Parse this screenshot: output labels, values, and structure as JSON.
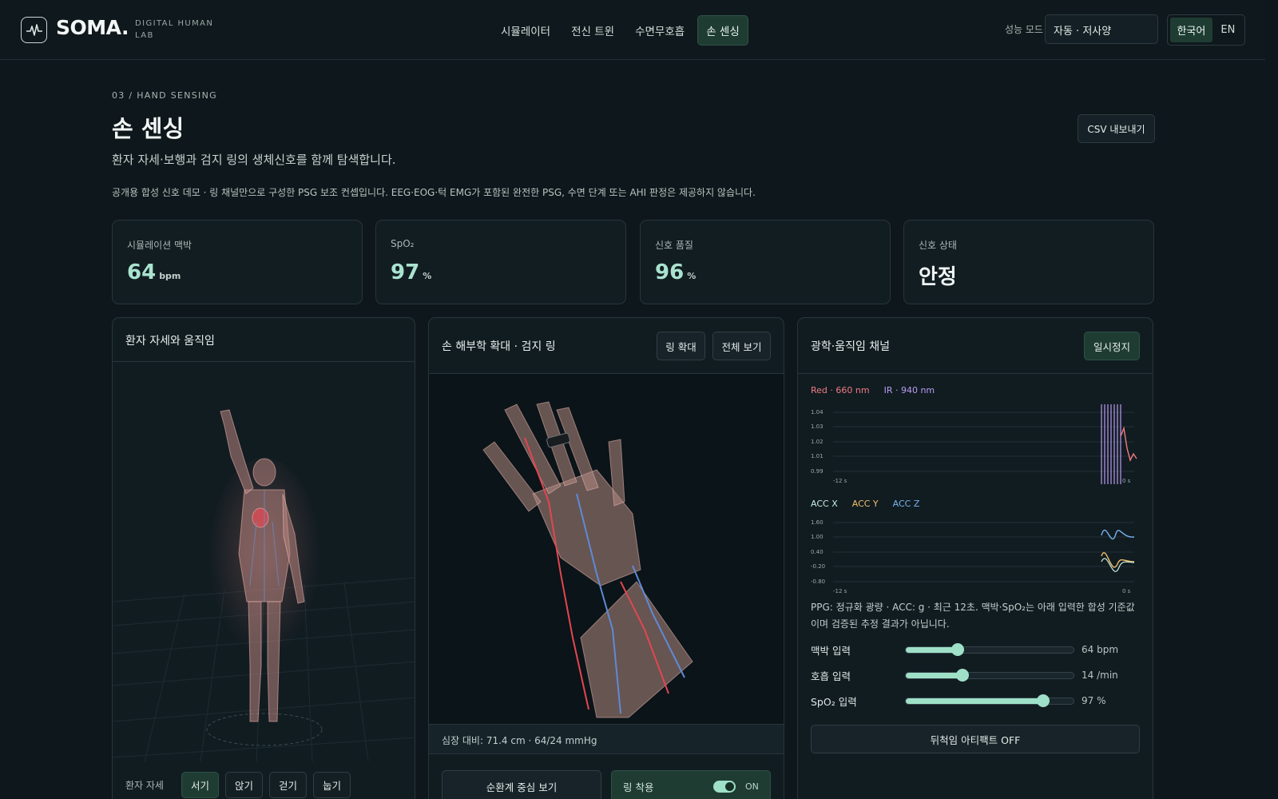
{
  "brand": {
    "name": "SOMA.",
    "sub": "DIGITAL HUMAN LAB"
  },
  "nav": [
    "시뮬레이터",
    "전신 트윈",
    "수면무호흡",
    "손 센싱"
  ],
  "perf": {
    "label": "성능 모드",
    "value": "자동 · 저사양"
  },
  "lang": {
    "ko": "한국어",
    "en": "EN"
  },
  "page": {
    "crumb": "03 / HAND SENSING",
    "title": "손 센싱",
    "subtitle": "환자 자세·보행과 검지 링의 생체신호를 함께 탐색합니다.",
    "note": "공개용 합성 신호 데모 · 링 채널만으로 구성한 PSG 보조 컨셉입니다. EEG·EOG·턱 EMG가 포함된 완전한 PSG, 수면 단계 또는 AHI 판정은 제공하지 않습니다.",
    "csv": "CSV 내보내기"
  },
  "stats": [
    {
      "label": "시뮬레이션 맥박",
      "value": "64",
      "unit": "bpm"
    },
    {
      "label": "SpO₂",
      "value": "97",
      "unit": "%"
    },
    {
      "label": "신호 품질",
      "value": "96",
      "unit": "%"
    },
    {
      "label": "신호 상태",
      "value": "안정",
      "unit": ""
    }
  ],
  "posture": {
    "title": "환자 자세와 움직임",
    "label": "환자 자세",
    "options": [
      "서기",
      "앉기",
      "걷기",
      "눕기"
    ],
    "active": "서기"
  },
  "hand": {
    "title": "손 해부학 확대 · 검지 링",
    "btn_zoom": "링 확대",
    "btn_full": "전체 보기",
    "footer": "심장 대비: 71.4 cm · 64/24 mmHg",
    "btn_circ": "순환계 중심 보기",
    "ring_label": "링 착용",
    "ring_state": "ON"
  },
  "channels": {
    "title": "광학·움직임 채널",
    "pause": "일시정지",
    "ppg_legend": [
      {
        "label": "Red · 660 nm",
        "color": "#f07b82"
      },
      {
        "label": "IR · 940 nm",
        "color": "#b99cf2"
      }
    ],
    "acc_legend": [
      {
        "label": "ACC X",
        "color": "#c9ecdc"
      },
      {
        "label": "ACC Y",
        "color": "#f2c16a"
      },
      {
        "label": "ACC Z",
        "color": "#79b4f0"
      }
    ],
    "ppg_ticks": [
      "1.04",
      "1.03",
      "1.02",
      "1.01",
      "0.99"
    ],
    "acc_ticks": [
      "1.60",
      "1.00",
      "0.40",
      "-0.20",
      "-0.80"
    ],
    "x_start": "-12 s",
    "x_end": "0 s",
    "desc": "PPG: 정규화 광량 · ACC: g · 최근 12초. 맥박·SpO₂는 아래 입력한 합성 기준값이며 검증된 추정 결과가 아닙니다.",
    "sliders": [
      {
        "label": "맥박 입력",
        "value": "64 bpm",
        "fraction": 0.31
      },
      {
        "label": "호흡 입력",
        "value": "14 /min",
        "fraction": 0.34
      },
      {
        "label": "SpO₂ 입력",
        "value": "97 %",
        "fraction": 0.82
      }
    ],
    "artifact": "뒤척임 아티팩트 OFF"
  }
}
